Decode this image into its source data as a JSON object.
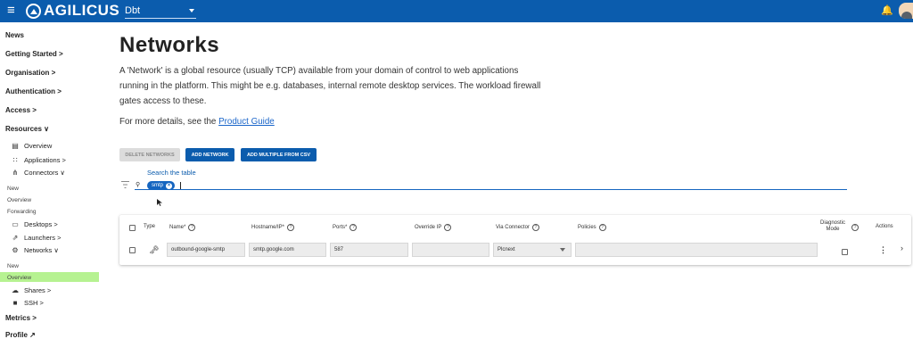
{
  "app": {
    "brand": "AGILICUS",
    "org": "Dbt",
    "menu_icon": "hamburger-icon",
    "bell_icon": "bell-icon"
  },
  "sidebar": {
    "news": "News",
    "getting_started": "Getting Started >",
    "organisation": "Organisation >",
    "authentication": "Authentication >",
    "access": "Access >",
    "resources": "Resources ∨",
    "overview": "Overview",
    "applications": "Applications >",
    "connectors": "Connectors ∨",
    "conn_new": "New",
    "conn_overview": "Overview",
    "conn_forwarding": "Forwarding",
    "desktops": "Desktops >",
    "launchers": "Launchers >",
    "networks": "Networks ∨",
    "net_new": "New",
    "net_overview": "Overview",
    "shares": "Shares >",
    "ssh": "SSH >",
    "metrics": "Metrics >",
    "profile": "Profile ↗"
  },
  "main": {
    "title": "Networks",
    "description": "A 'Network' is a global resource (usually TCP) available from your domain of control to web applications running in the platform.   This might be e.g. databases, internal remote desktop services. The workload firewall gates access to these.",
    "details_prefix": "For more details, see the ",
    "details_link": "Product Guide",
    "buttons": {
      "delete": "DELETE NETWORKS",
      "add": "ADD NETWORK",
      "add_csv": "ADD MULTIPLE FROM CSV"
    },
    "search_label": "Search the table",
    "chip": "smtp"
  },
  "table": {
    "headers": {
      "type": "Type",
      "name": "Name*",
      "hostname": "Hostname/IP*",
      "ports": "Ports*",
      "override_ip": "Override IP",
      "via_connector": "Via Connector",
      "policies": "Policies",
      "diagnostic_1": "Diagnostic",
      "diagnostic_2": "Mode",
      "actions": "Actions"
    },
    "row": {
      "name": "outbound-google-smtp",
      "hostname": "smtp.google.com",
      "ports": "587",
      "override_ip": "",
      "connector": "Plcnext",
      "policies": ""
    }
  }
}
